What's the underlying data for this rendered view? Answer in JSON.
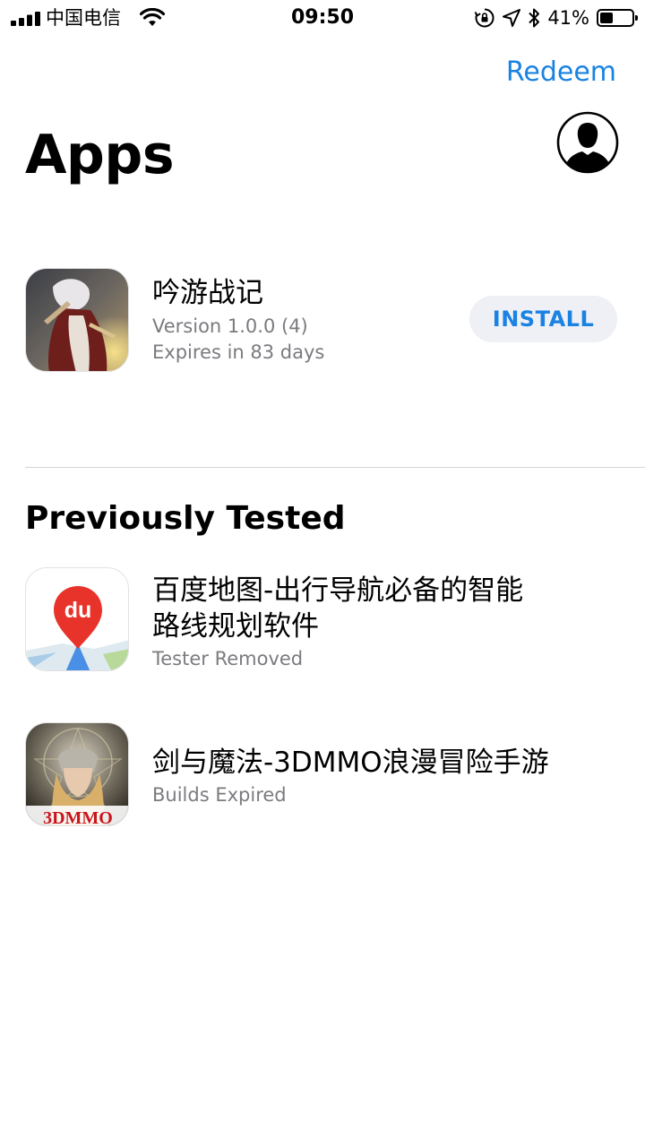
{
  "status_bar": {
    "carrier": "中国电信",
    "time": "09:50",
    "battery_percent_text": "41%",
    "battery_level": 0.41
  },
  "header": {
    "redeem_label": "Redeem",
    "title": "Apps"
  },
  "apps": [
    {
      "name": "吟游战记",
      "version": "Version 1.0.0 (4)",
      "expires": "Expires in 83 days",
      "action_label": "INSTALL"
    }
  ],
  "previously_tested": {
    "title": "Previously Tested",
    "items": [
      {
        "name_line1": "百度地图-出行导航必备的智能",
        "name_line2": "路线规划软件",
        "status": "Tester Removed",
        "icon_text": "du"
      },
      {
        "name": "剑与魔法-3DMMO浪漫冒险手游",
        "status": "Builds Expired",
        "icon_text": "3DMMO"
      }
    ]
  },
  "colors": {
    "accent": "#1a82e2",
    "secondary_text": "#7b7b80",
    "button_bg": "#eff0f5",
    "baidu_red": "#e8332b"
  }
}
